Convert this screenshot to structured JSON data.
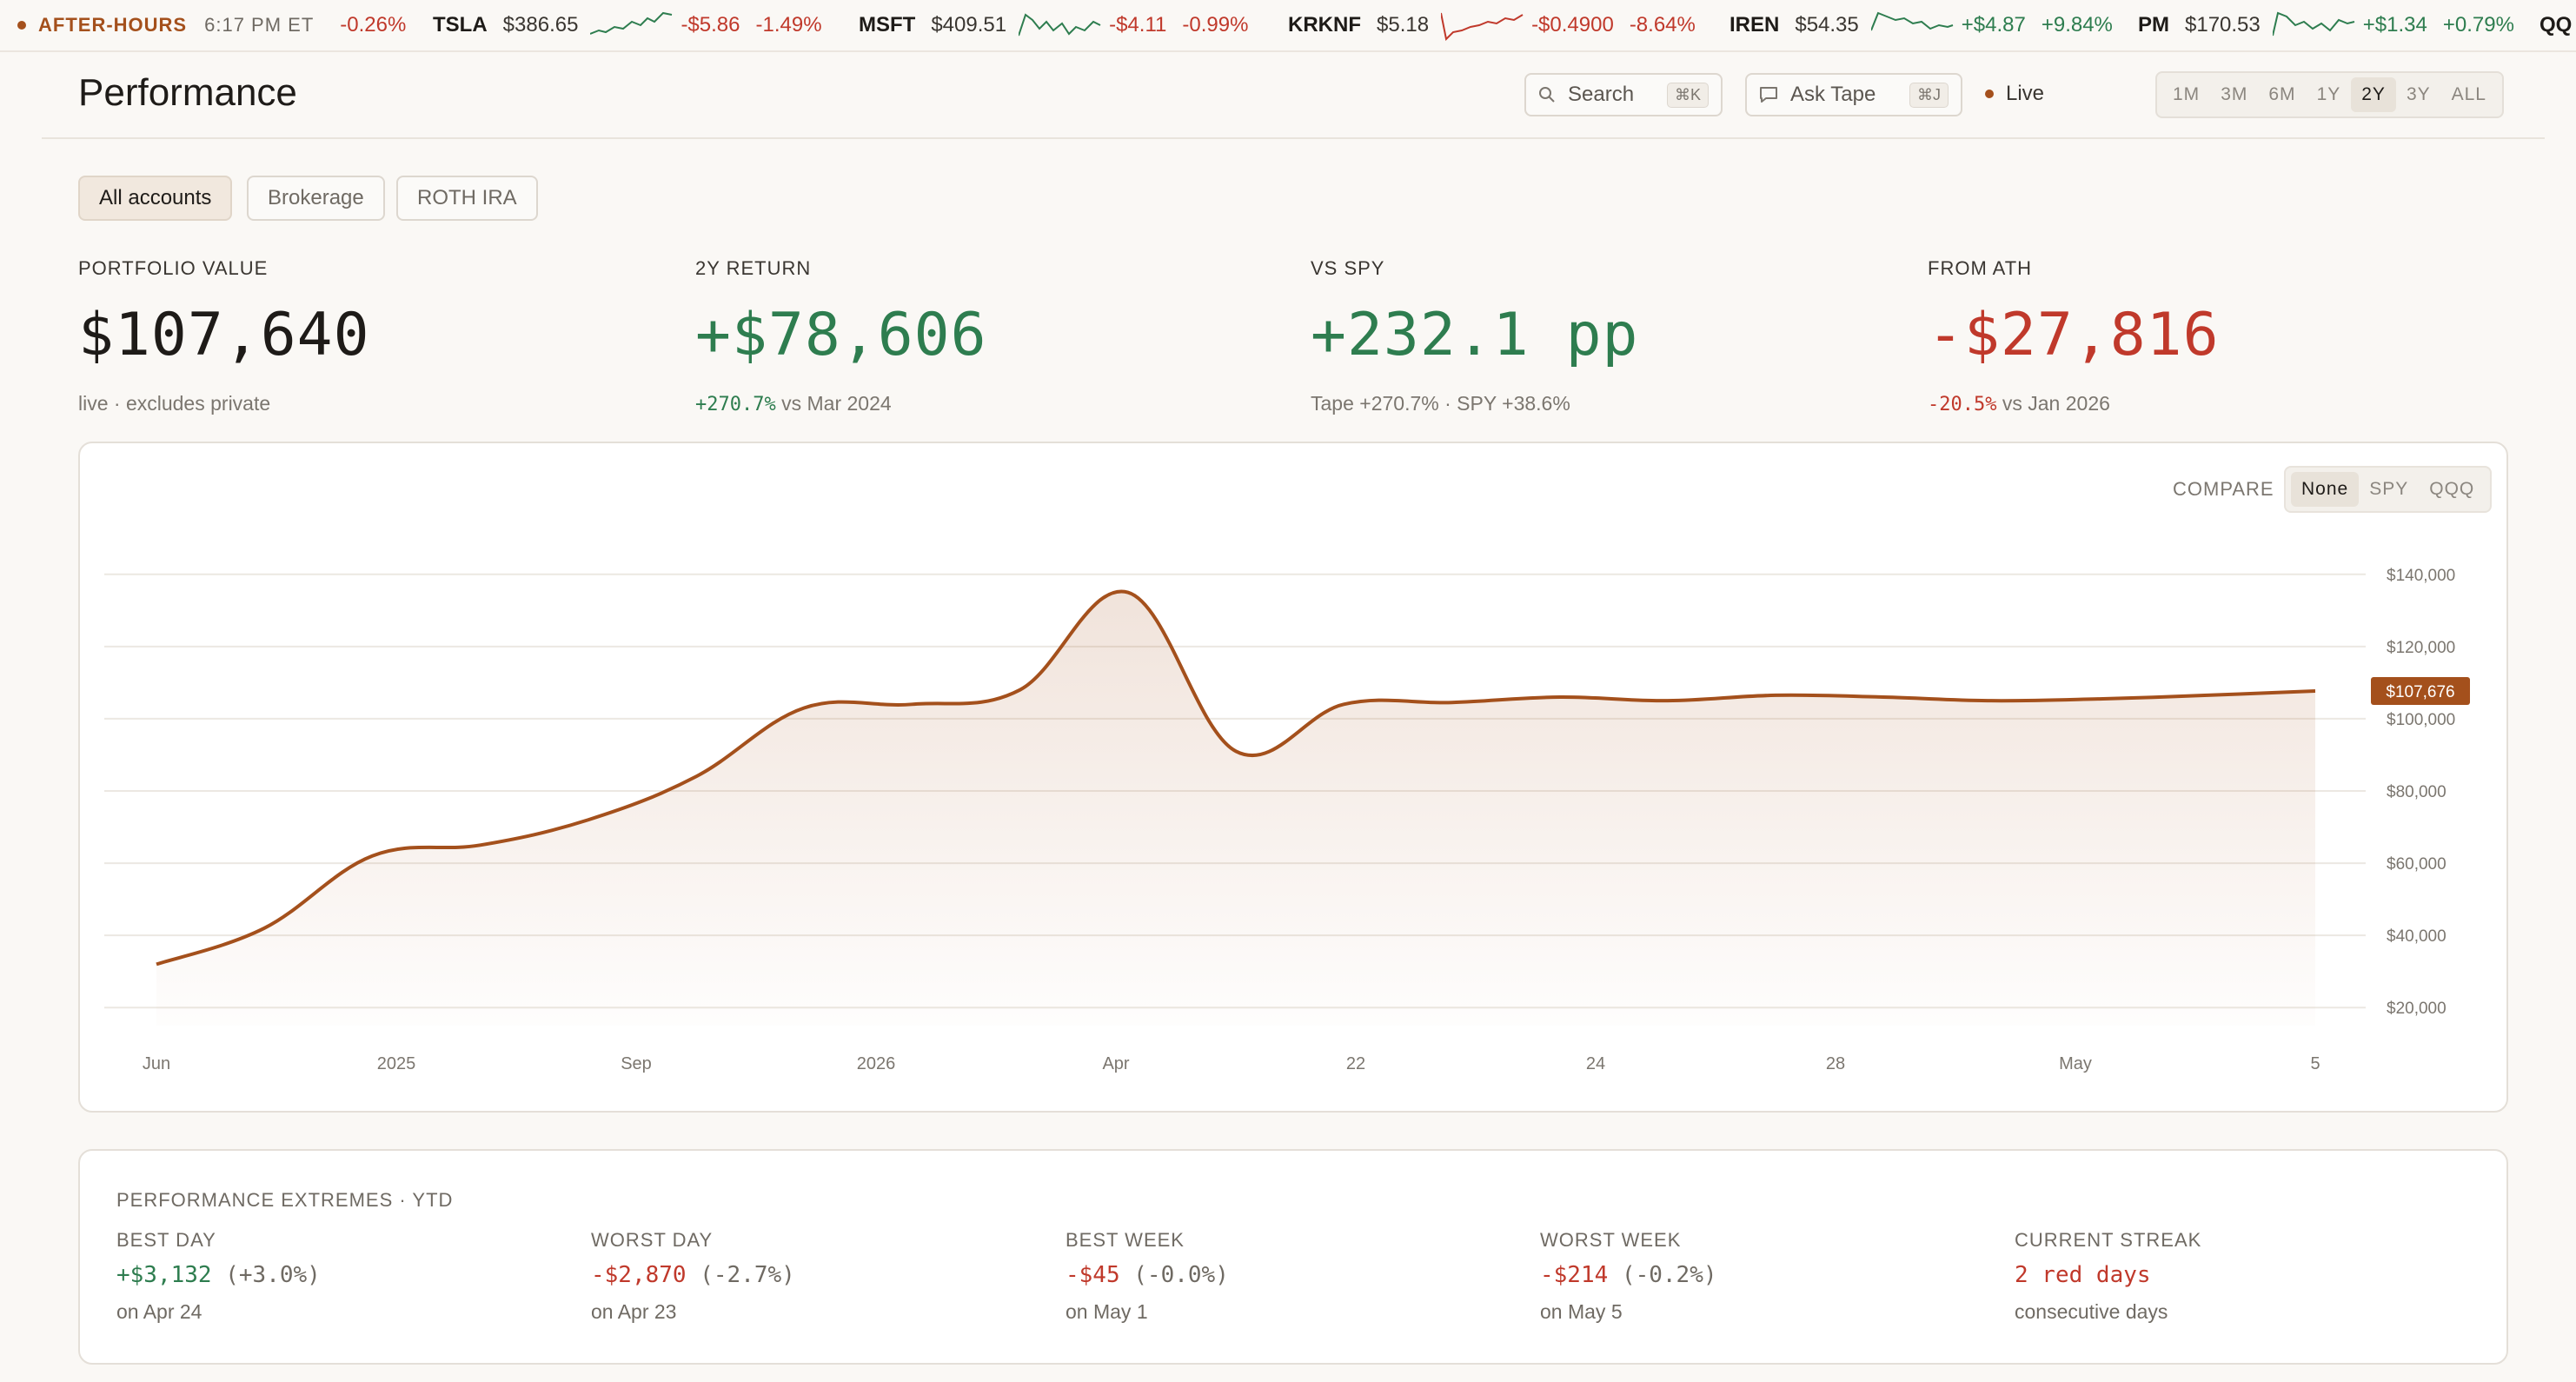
{
  "ticker": {
    "after_hours_label": "AFTER-HOURS",
    "after_hours_time": "6:17 PM ET",
    "lead_change": "-0.26%",
    "items": [
      {
        "symbol": "TSLA",
        "price": "$386.65",
        "change": "-$5.86",
        "pct": "-1.49%",
        "dir": "neg"
      },
      {
        "symbol": "MSFT",
        "price": "$409.51",
        "change": "-$4.11",
        "pct": "-0.99%",
        "dir": "neg"
      },
      {
        "symbol": "KRKNF",
        "price": "$5.18",
        "change": "-$0.4900",
        "pct": "-8.64%",
        "dir": "neg"
      },
      {
        "symbol": "IREN",
        "price": "$54.35",
        "change": "+$4.87",
        "pct": "+9.84%",
        "dir": "pos"
      },
      {
        "symbol": "PM",
        "price": "$170.53",
        "change": "+$1.34",
        "pct": "+0.79%",
        "dir": "pos"
      },
      {
        "symbol": "QQ",
        "price": "",
        "change": "",
        "pct": "",
        "dir": "pos"
      }
    ]
  },
  "header": {
    "title": "Performance",
    "search_label": "Search",
    "search_kbd": "⌘K",
    "ask_label": "Ask Tape",
    "ask_kbd": "⌘J",
    "live_label": "Live",
    "ranges": [
      "1M",
      "3M",
      "6M",
      "1Y",
      "2Y",
      "3Y",
      "ALL"
    ],
    "active_range": "2Y"
  },
  "accounts": {
    "tabs": [
      "All accounts",
      "Brokerage",
      "ROTH IRA"
    ],
    "active": "All accounts"
  },
  "stats": [
    {
      "label": "PORTFOLIO VALUE",
      "value": "$107,640",
      "sub_a": "",
      "sub_b": "live  · excludes private",
      "tone": "neutral"
    },
    {
      "label": "2Y RETURN",
      "value": "+$78,606",
      "sub_a": "+270.7%",
      "sub_b": "vs Mar 2024",
      "tone": "pos"
    },
    {
      "label": "VS SPY",
      "value": "+232.1 pp",
      "sub_a": "",
      "sub_b": "Tape +270.7%  ·  SPY +38.6%",
      "tone": "pos"
    },
    {
      "label": "FROM ATH",
      "value": "-$27,816",
      "sub_a": "-20.5%",
      "sub_b": "vs Jan 2026",
      "tone": "neg"
    }
  ],
  "compare": {
    "label": "COMPARE",
    "options": [
      "None",
      "SPY",
      "QQQ"
    ],
    "active": "None"
  },
  "chart_data": {
    "type": "area",
    "title": "",
    "xlabel": "",
    "ylabel": "",
    "ylim": [
      15000,
      145000
    ],
    "yticks": [
      20000,
      40000,
      60000,
      80000,
      100000,
      120000,
      140000
    ],
    "ytick_labels": [
      "$20,000",
      "$40,000",
      "$60,000",
      "$80,000",
      "$100,000",
      "$120,000",
      "$140,000"
    ],
    "xtick_labels": [
      "Jun",
      "2025",
      "Sep",
      "2026",
      "Apr",
      "22",
      "24",
      "28",
      "May",
      "5"
    ],
    "current_value_label": "$107,676",
    "current_value": 107676,
    "color": "#a4501c",
    "grid": true,
    "series": [
      {
        "x": [
          0,
          0.5,
          1,
          1.5,
          2,
          2.5,
          3,
          3.5,
          4,
          4.5,
          5,
          5.5,
          6,
          6.5,
          7,
          7.5,
          8,
          8.5,
          9,
          9.5,
          10
        ],
        "values": [
          32000,
          42000,
          62000,
          65000,
          72000,
          84000,
          103000,
          104000,
          108000,
          135000,
          91000,
          104000,
          104500,
          106000,
          105000,
          106500,
          106000,
          105000,
          105500,
          106500,
          107676
        ]
      }
    ]
  },
  "extremes": {
    "title": "PERFORMANCE EXTREMES · YTD",
    "items": [
      {
        "label": "BEST DAY",
        "value": "+$3,132",
        "pct": "(+3.0%)",
        "sub": "on Apr 24",
        "tone": "pos"
      },
      {
        "label": "WORST DAY",
        "value": "-$2,870",
        "pct": "(-2.7%)",
        "sub": "on Apr 23",
        "tone": "neg"
      },
      {
        "label": "BEST WEEK",
        "value": "-$45",
        "pct": "(-0.0%)",
        "sub": "on May 1",
        "tone": "neg"
      },
      {
        "label": "WORST WEEK",
        "value": "-$214",
        "pct": "(-0.2%)",
        "sub": "on May 5",
        "tone": "neg"
      },
      {
        "label": "CURRENT STREAK",
        "value": "2 red days",
        "pct": "",
        "sub": "consecutive days",
        "tone": "neg"
      }
    ]
  },
  "colors": {
    "accent": "#a4501c",
    "positive": "#2e7d4f",
    "negative": "#c0392b"
  }
}
